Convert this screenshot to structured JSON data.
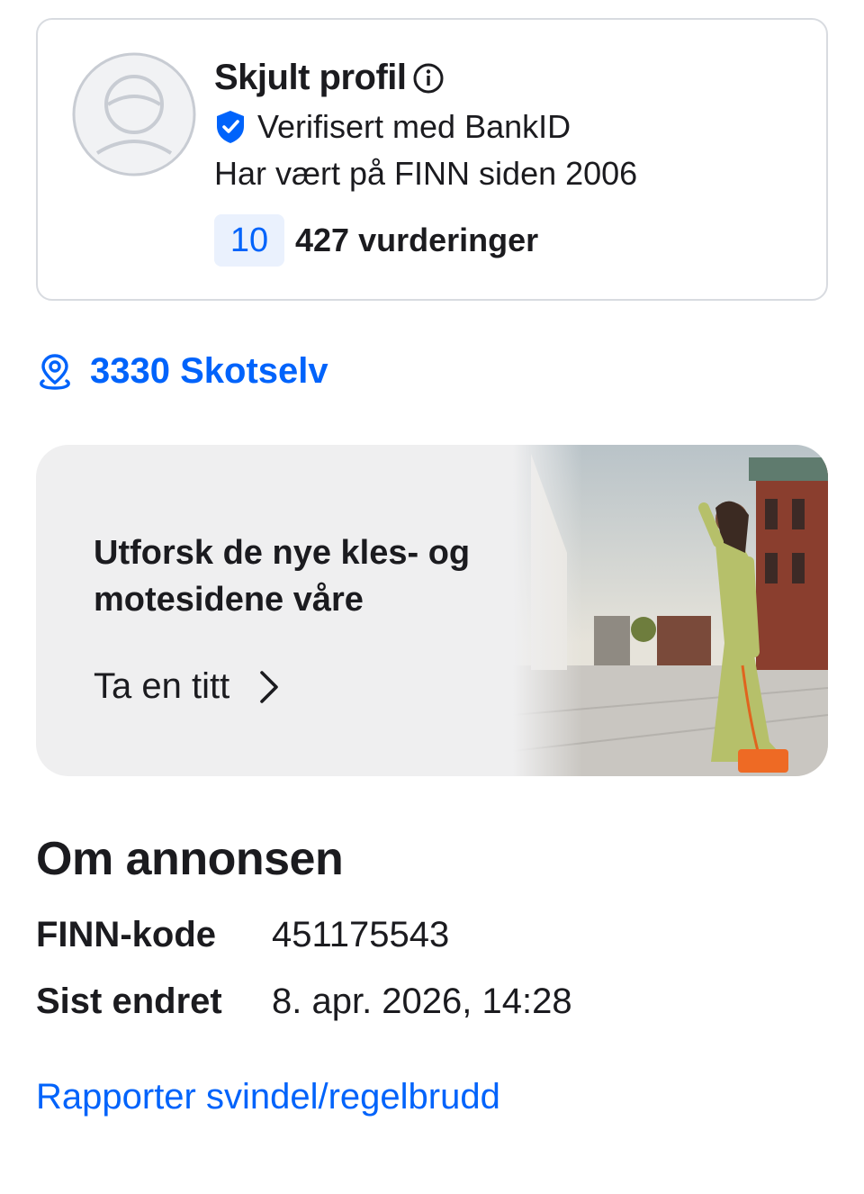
{
  "profile": {
    "name": "Skjult profil",
    "verified": "Verifisert med BankID",
    "member_since": "Har vært på FINN siden 2006",
    "rating_score": "10",
    "rating_count": "427 vurderinger"
  },
  "location": {
    "label": "3330 Skotselv"
  },
  "promo": {
    "title": "Utforsk de nye kles- og motesidene våre",
    "cta": "Ta en titt"
  },
  "about": {
    "title": "Om annonsen",
    "rows": [
      {
        "label": "FINN-kode",
        "value": "451175543"
      },
      {
        "label": "Sist endret",
        "value": "8. apr. 2026, 14:28"
      }
    ]
  },
  "report": {
    "label": "Rapporter svindel/regelbrudd"
  },
  "colors": {
    "accent": "#0063fb",
    "badge_bg": "#eaf1fd",
    "banner_bg": "#efeff0",
    "text": "#1b1b1f"
  },
  "icons": [
    "avatar-placeholder-icon",
    "info-icon",
    "shield-check-icon",
    "location-pin-icon",
    "chevron-right-icon"
  ]
}
